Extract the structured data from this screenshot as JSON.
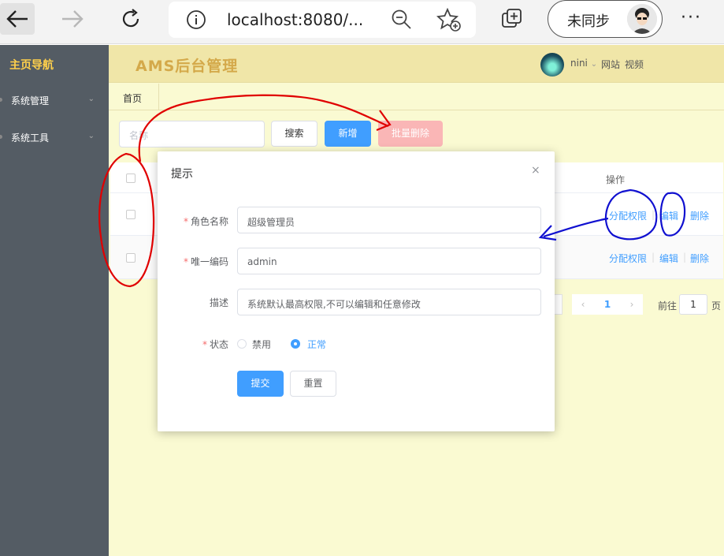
{
  "browser": {
    "url": "localhost:8080/...",
    "sync_label": "未同步",
    "more": "···",
    "icons": [
      "back-arrow-icon",
      "forward-arrow-icon",
      "reload-icon",
      "info-icon",
      "zoom-out-icon",
      "add-favorite-icon",
      "collections-icon",
      "profile-avatar"
    ]
  },
  "sidebar": {
    "header": "主页导航",
    "items": [
      {
        "label": "系统管理"
      },
      {
        "label": "系统工具"
      }
    ]
  },
  "header": {
    "brand": "AMS后台管理",
    "user": "nini",
    "links": [
      "网站",
      "视频"
    ]
  },
  "tabs": [
    {
      "label": "首页"
    }
  ],
  "toolbar": {
    "search_placeholder": "名称",
    "search_label": "搜索",
    "add_label": "新增",
    "batch_delete_label": "批量删除"
  },
  "table": {
    "op_header": "操作",
    "rows": [
      {
        "actions": [
          "分配权限",
          "编辑",
          "删除"
        ]
      },
      {
        "actions": [
          "分配权限",
          "编辑",
          "删除"
        ]
      }
    ]
  },
  "pagination": {
    "prev": "‹",
    "current": "1",
    "next": "›",
    "goto_label": "前往",
    "goto_value": "1",
    "goto_unit": "页"
  },
  "dialog": {
    "title": "提示",
    "close": "×",
    "fields": {
      "name": {
        "label": "角色名称",
        "value": "超级管理员",
        "required": true
      },
      "code": {
        "label": "唯一编码",
        "value": "admin",
        "required": true
      },
      "description": {
        "label": "描述",
        "value": "系统默认最高权限,不可以编辑和任意修改",
        "required": false
      },
      "status": {
        "label": "状态",
        "required": true,
        "options": [
          "禁用",
          "正常"
        ],
        "selected": "正常"
      }
    },
    "submit_label": "提交",
    "reset_label": "重置"
  },
  "colors": {
    "primary": "#409eff",
    "danger_light": "#fab6b6",
    "sidebar_bg": "#545c64",
    "sidebar_active": "#ffd04b",
    "main_bg": "#fafad2",
    "brand": "#d4a94a",
    "annotation_red": "#e00000",
    "annotation_blue": "#1010d0"
  }
}
